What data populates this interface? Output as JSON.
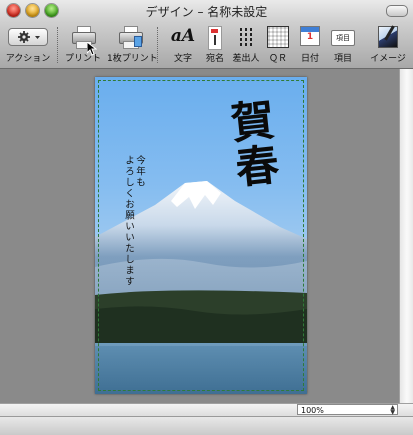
{
  "window": {
    "title": "デザイン – 名称未設定"
  },
  "toolbar": {
    "items": [
      {
        "label": "アクション",
        "icon": "gear-icon"
      },
      {
        "label": "プリント",
        "icon": "printer-icon"
      },
      {
        "label": "1枚プリント",
        "icon": "printer-single-icon"
      },
      {
        "label": "文字",
        "icon": "font-icon",
        "glyph": "aA"
      },
      {
        "label": "宛名",
        "icon": "address-icon"
      },
      {
        "label": "差出人",
        "icon": "sender-icon"
      },
      {
        "label": "ＱＲ",
        "icon": "qr-code-icon"
      },
      {
        "label": "日付",
        "icon": "calendar-icon",
        "glyph": "1"
      },
      {
        "label": "項目",
        "icon": "item-icon",
        "glyph": "項目"
      },
      {
        "label": "イメージ",
        "icon": "image-icon"
      }
    ]
  },
  "card": {
    "greeting": "賀春",
    "message": "今年も\nよろしくお願いいたします",
    "message_line1": "今年も",
    "message_line2": "よろしくお願いいたします"
  },
  "zoom": {
    "value": "100%"
  },
  "colors": {
    "sky": "#7ab6ef",
    "lake": "#4e7fa3",
    "guide": "#2f7a37"
  }
}
